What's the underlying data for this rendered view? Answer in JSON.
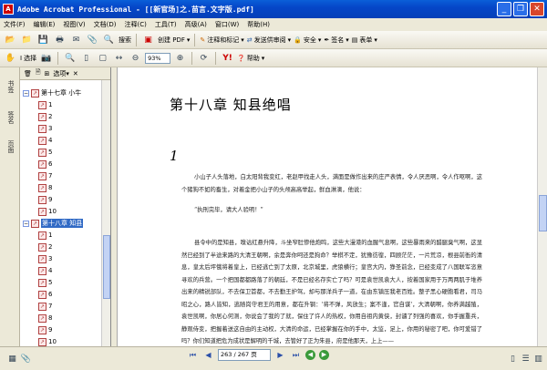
{
  "window": {
    "title": "Adobe Acrobat Professional - [[新官场]之.苗言.文字版.pdf]",
    "app_icon": "A"
  },
  "menu": [
    "文件(F)",
    "编辑(E)",
    "视图(V)",
    "文档(D)",
    "注释(C)",
    "工具(T)",
    "高级(A)",
    "窗口(W)",
    "帮助(H)"
  ],
  "toolbar1": {
    "search_label": "搜索",
    "create_pdf": "创建 PDF",
    "comment_mark": "注释和标记",
    "send_review": "发送供审阅",
    "security": "安全",
    "sign": "签名",
    "forms": "表单"
  },
  "toolbar2": {
    "select_label": "选择",
    "zoom_value": "93%",
    "help_label": "帮助"
  },
  "side_tabs": [
    "书签",
    "签名",
    "页面"
  ],
  "panel": {
    "options_label": "选项"
  },
  "tree": {
    "ch17": "第十七章 小牛",
    "ch17_items": [
      "1",
      "2",
      "3",
      "4",
      "5",
      "6",
      "7",
      "8",
      "9",
      "10"
    ],
    "ch18": "第十八章 知县",
    "ch18_items": [
      "1",
      "2",
      "3",
      "4",
      "5",
      "6",
      "7",
      "8",
      "9",
      "10",
      "11",
      "12"
    ]
  },
  "page": {
    "chapter_title": "第十八章  知县绝唱",
    "section_num": "1",
    "paragraphs": [
      "小山子人头落地，白太阳背我变红，老赵甲找走人头，满面是做作出来的庄严表情，令人厌恶啊，令人作呕啊，这个猪狗不如的畜生，对着金把小山子的头颅高高举起，鲜血淋漓，他说：",
      "“执刑完毕，请大人验明！”",
      "县令中的是知县，嗅诂红悬升降，斗坐窄肚惨他炮鸣，这些大漫港的血腥气息啊，这些暴雨来的醋腿臭气啊，这显然已经到了半途来路的大清王朝啊，余是奔你呵还是狗命？举棋不定，犹豫彷徨，四顾茫茫，一片荒凉，根县前衙的清息，皇太后坪俄将着皇上，已经逃亡到了太原，北京城里，虎狼横行；皇宫大内，狰圣前念，已经变成了八国联军恣意寻欢的兵营。一个把国都都路落了的朝廷，不是已经名存实亡了吗？可是袁世凯袁大人，按着国家用于万两两肌于堆养出来的精锐部队，不去保卫首都，不去勤王护驾，却与那洋兵子一道，在由东镇压我老百姓。整子黑心硬胞看君，司马昭之心，路人皆知，逃随岗守君王的用意，都在升钢：'将不弹，风放生；案不逢，官自谋'，大清朝啊，你养满越殖，袁世凯啊，你居心何测，你说会了我的了就，保住了许人的热权，你用自祖内黄侠，封谴了列强的喜欢，你手握重兵，静观侍变，把握着送这自由的主动权，大清的命运，已经掌握在你的手中，太监，足上，你用的秘密了吧，你可爱错了吗？你们知道把危为成状是解明的千城，去管好了正为朱县，府是他那天，上上——"
    ]
  },
  "status": {
    "page_box": "263 / 267 页"
  }
}
